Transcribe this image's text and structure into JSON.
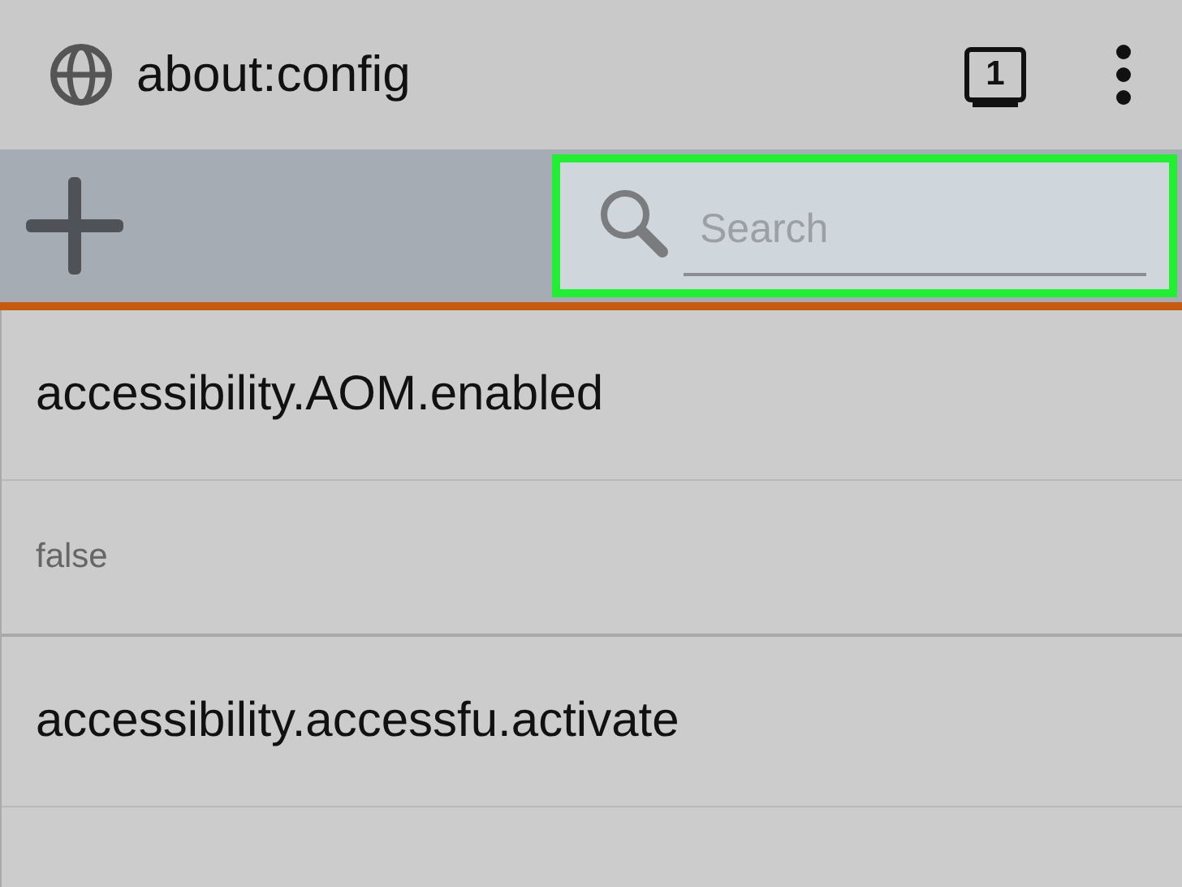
{
  "address_bar": {
    "url": "about:config",
    "tab_count": "1"
  },
  "toolbar": {
    "search": {
      "placeholder": "Search",
      "highlighted": true
    }
  },
  "preferences": [
    {
      "name": "accessibility.AOM.enabled",
      "value": "false"
    },
    {
      "name": "accessibility.accessfu.activate"
    }
  ]
}
